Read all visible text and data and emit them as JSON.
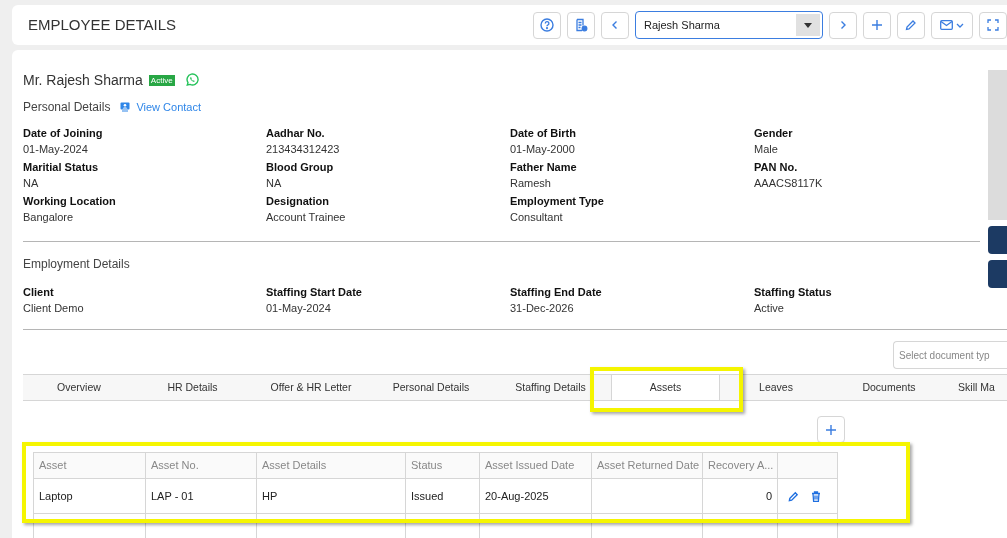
{
  "header": {
    "title": "EMPLOYEE DETAILS",
    "employee_select": {
      "value": "Rajesh Sharma"
    }
  },
  "profile": {
    "name": "Mr. Rajesh Sharma",
    "status_badge": "Active",
    "section": "Personal Details",
    "view_contact": "View Contact"
  },
  "personal_fields": [
    {
      "label": "Date of Joining",
      "value": "01-May-2024"
    },
    {
      "label": "Aadhar No.",
      "value": "213434312423"
    },
    {
      "label": "Date of Birth",
      "value": "01-May-2000"
    },
    {
      "label": "Gender",
      "value": "Male"
    },
    {
      "label": "Maritial Status",
      "value": "NA"
    },
    {
      "label": "Blood Group",
      "value": "NA"
    },
    {
      "label": "Father Name",
      "value": "Ramesh"
    },
    {
      "label": "PAN No.",
      "value": "AAACS8117K"
    },
    {
      "label": "Working Location",
      "value": "Bangalore"
    },
    {
      "label": "Designation",
      "value": "Account Trainee"
    },
    {
      "label": "Employment Type",
      "value": "Consultant"
    }
  ],
  "employment": {
    "section": "Employment Details",
    "fields": [
      {
        "label": "Client",
        "value": "Client Demo"
      },
      {
        "label": "Staffing Start Date",
        "value": "01-May-2024"
      },
      {
        "label": "Staffing End Date",
        "value": "31-Dec-2026"
      },
      {
        "label": "Staffing Status",
        "value": "Active"
      }
    ]
  },
  "document_type": {
    "placeholder": "Select document typ"
  },
  "tabs": [
    {
      "label": "Overview",
      "selected": false,
      "highlighted": false
    },
    {
      "label": "HR Details",
      "selected": false,
      "highlighted": false
    },
    {
      "label": "Offer & HR Letter",
      "selected": false,
      "highlighted": false
    },
    {
      "label": "Personal Details",
      "selected": false,
      "highlighted": false
    },
    {
      "label": "Staffing Details",
      "selected": false,
      "highlighted": false
    },
    {
      "label": "Assets",
      "selected": true,
      "highlighted": true
    },
    {
      "label": "Leaves",
      "selected": false,
      "highlighted": false
    },
    {
      "label": "Documents",
      "selected": false,
      "highlighted": false
    },
    {
      "label": "Skill Ma",
      "selected": false,
      "highlighted": false
    }
  ],
  "assets_table": {
    "highlighted": true,
    "columns": [
      "Asset",
      "Asset No.",
      "Asset Details",
      "Status",
      "Asset Issued Date",
      "Asset Returned Date",
      "Recovery A..."
    ],
    "rows": [
      [
        "Laptop",
        "LAP - 01",
        "HP",
        "Issued",
        "20-Aug-2025",
        "",
        "0"
      ]
    ]
  }
}
